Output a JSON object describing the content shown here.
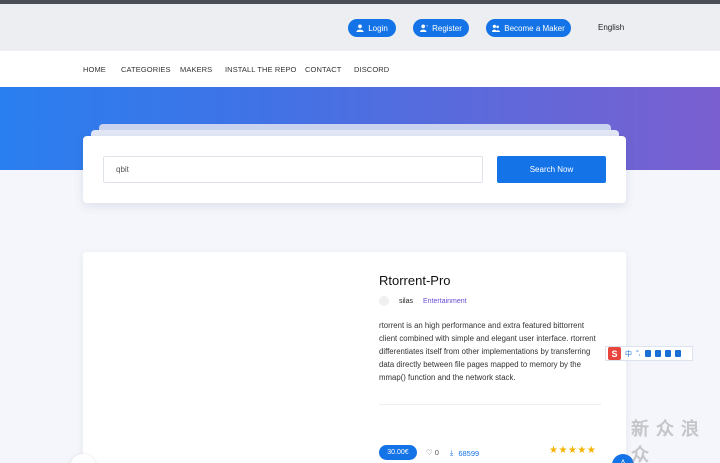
{
  "topbar": {
    "login_label": "Login",
    "register_label": "Register",
    "maker_label": "Become a Maker",
    "language": "English"
  },
  "nav": {
    "items": [
      {
        "label": "HOME"
      },
      {
        "label": "CATEGORIES"
      },
      {
        "label": "MAKERS"
      },
      {
        "label": "INSTALL THE REPO"
      },
      {
        "label": "CONTACT"
      },
      {
        "label": "DISCORD"
      }
    ]
  },
  "search": {
    "value": "qbit",
    "button_label": "Search Now"
  },
  "app": {
    "title": "Rtorrent-Pro",
    "maker": "silas",
    "category": "Entertainment",
    "description": "rtorrent is an high performance and extra featured bittorrent client combined with simple and elegant user interface. rtorrent differentiates itself from other implementations by transferring data directly between file pages mapped to memory by the mmap() function and the network stack.",
    "price": "30.00€",
    "likes": "0",
    "downloads": "68599",
    "rating_stars": 5
  },
  "ime": {
    "logo": "S",
    "mode": "中"
  },
  "watermark": "新 众 浪 众",
  "colors": {
    "accent": "#1473e6",
    "category": "#6a4bd6",
    "star": "#f6b400"
  }
}
